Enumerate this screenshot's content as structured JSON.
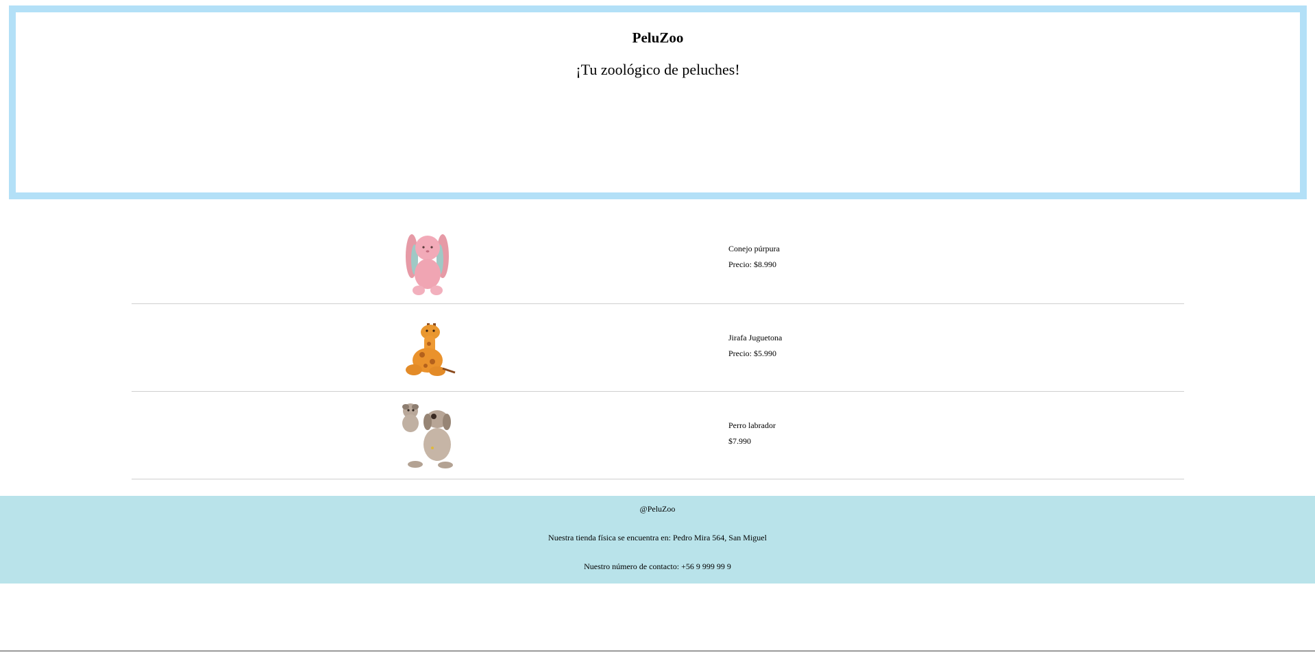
{
  "header": {
    "title": "PeluZoo",
    "tagline": "¡Tu zoológico de peluches!"
  },
  "products": [
    {
      "icon": "pink-bunny-plush-icon",
      "name": "Conejo púrpura",
      "price": "Precio: $8.990"
    },
    {
      "icon": "giraffe-plush-icon",
      "name": "Jirafa Juguetona",
      "price": "Precio: $5.990"
    },
    {
      "icon": "dog-plush-icon",
      "name": "Perro labrador",
      "price": "$7.990"
    }
  ],
  "footer": {
    "handle": "@PeluZoo",
    "address": "Nuestra tienda física se encuentra en: Pedro Mira 564, San Miguel",
    "contact": "Nuestro número de contacto: +56 9 999 99 9"
  },
  "colors": {
    "header_border": "#b3e0f7",
    "footer_bg": "#b9e3ea"
  }
}
